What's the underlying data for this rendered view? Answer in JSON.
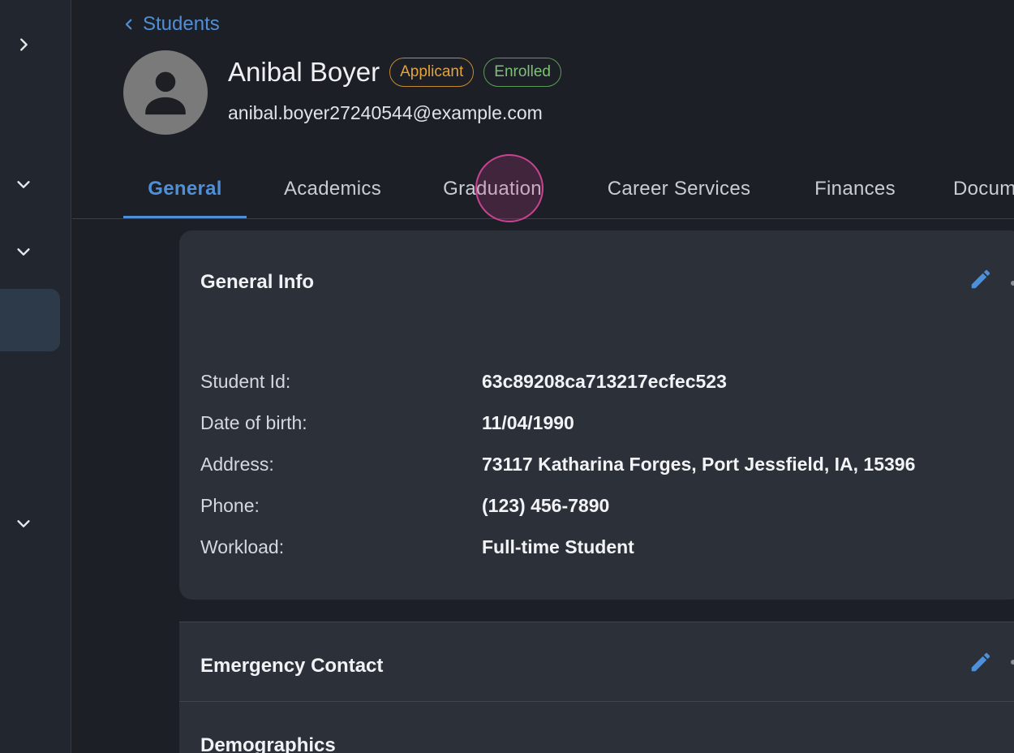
{
  "header": {
    "back_label": "Students",
    "student_name": "Anibal Boyer",
    "badges": [
      "Applicant",
      "Enrolled"
    ],
    "email": "anibal.boyer27240544@example.com"
  },
  "tabs": [
    {
      "label": "General",
      "active": true
    },
    {
      "label": "Academics",
      "active": false
    },
    {
      "label": "Graduation",
      "active": false
    },
    {
      "label": "Career Services",
      "active": false
    },
    {
      "label": "Finances",
      "active": false
    },
    {
      "label": "Documents",
      "active": false
    }
  ],
  "general_info": {
    "title": "General Info",
    "fields": [
      {
        "label": "Student Id:",
        "value": "63c89208ca713217ecfec523"
      },
      {
        "label": "Date of birth:",
        "value": "11/04/1990"
      },
      {
        "label": "Address:",
        "value": "73117 Katharina Forges, Port Jessfield, IA, 15396"
      },
      {
        "label": "Phone:",
        "value": "(123) 456-7890"
      },
      {
        "label": "Workload:",
        "value": "Full-time Student"
      }
    ]
  },
  "sections": [
    {
      "title": "Emergency Contact"
    },
    {
      "title": "Demographics"
    }
  ],
  "colors": {
    "accent": "#4f8fd8",
    "applicant": "#e3a43c",
    "enrolled": "#7fbf78",
    "card_bg": "#2c3038",
    "page_bg": "#1c1f26"
  },
  "icons": {
    "rail": [
      "chevron-right-icon",
      "chevron-down-icon",
      "chevron-down-icon",
      "chevron-down-icon"
    ],
    "back": "chevron-left-icon",
    "avatar": "person-icon",
    "edit": "pencil-icon"
  }
}
